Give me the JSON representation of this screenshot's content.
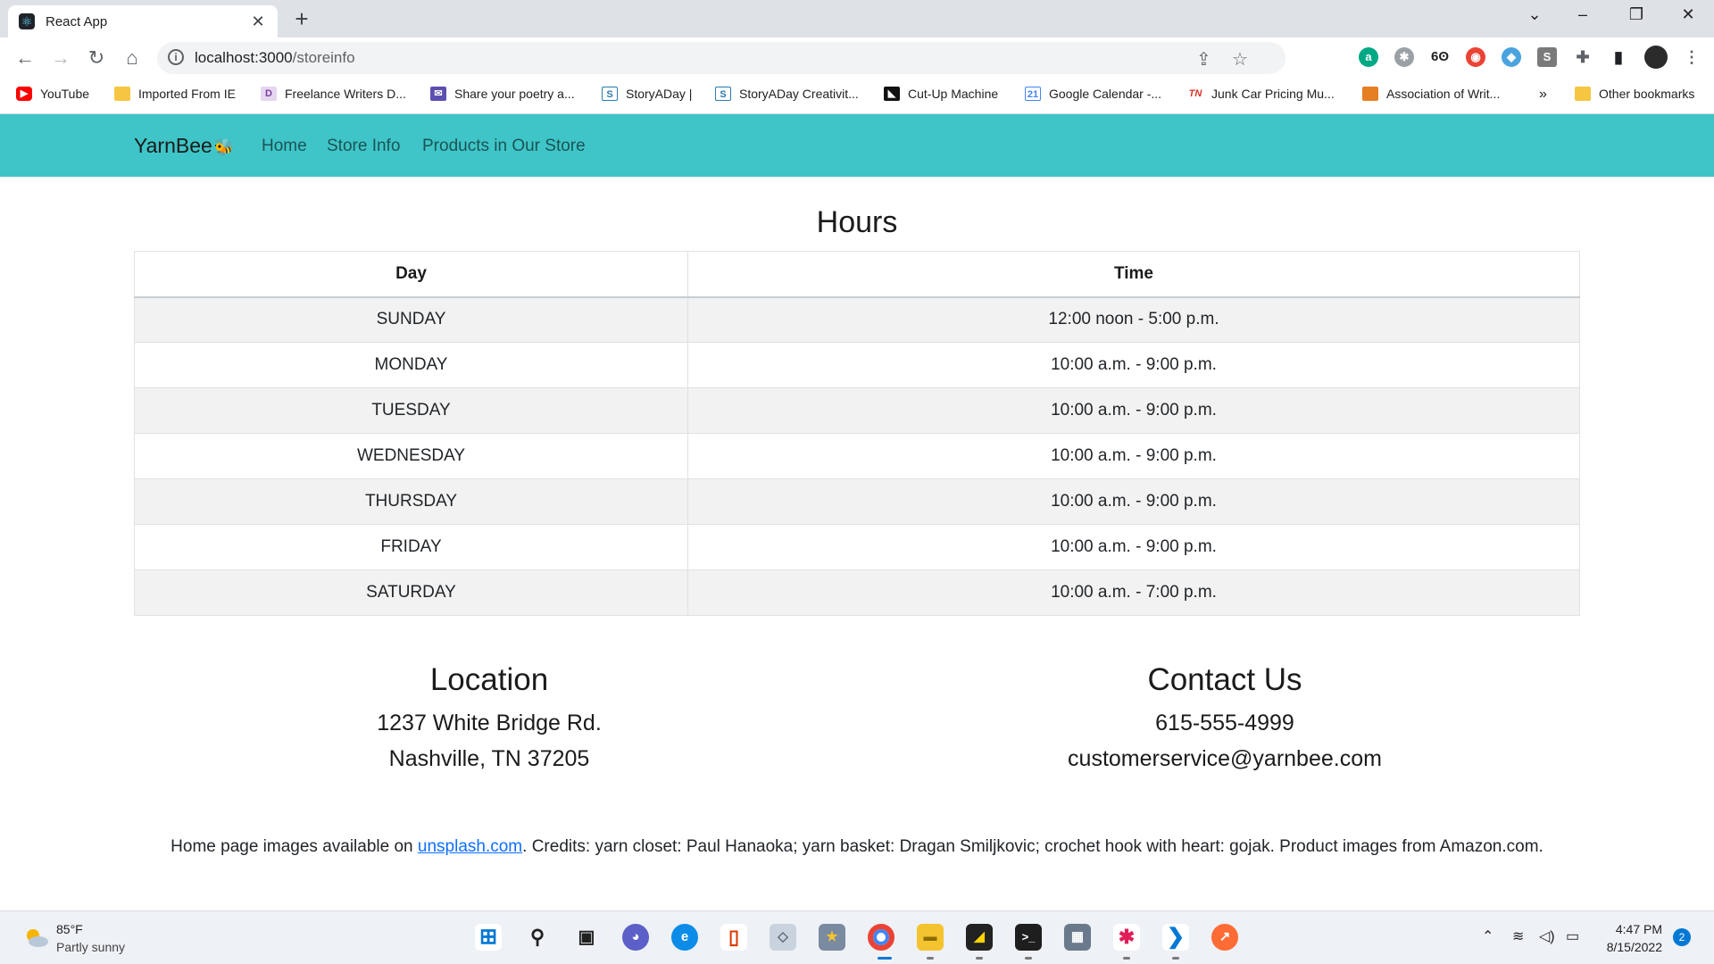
{
  "browser": {
    "tab_title": "React App",
    "url_host": "localhost:3000",
    "url_path": "/storeinfo",
    "bookmarks": [
      {
        "label": "YouTube",
        "icon": "youtube-icon",
        "color": "#ff0000"
      },
      {
        "label": "Imported From IE",
        "icon": "folder-icon",
        "color": "#f6c642"
      },
      {
        "label": "Freelance Writers D...",
        "icon": "d-icon",
        "color": "#9b59b6"
      },
      {
        "label": "Share your poetry a...",
        "icon": "poetry-icon",
        "color": "#5b4fb0"
      },
      {
        "label": "StoryADay |",
        "icon": "storyaday-icon",
        "color": "#2a7ab0"
      },
      {
        "label": "StoryADay Creativit...",
        "icon": "storyaday-icon",
        "color": "#2a7ab0"
      },
      {
        "label": "Cut-Up Machine",
        "icon": "cutup-icon",
        "color": "#111111"
      },
      {
        "label": "Google Calendar -...",
        "icon": "calendar-icon",
        "color": "#4285f4"
      },
      {
        "label": "Junk Car Pricing Mu...",
        "icon": "tn-icon",
        "color": "#d93025"
      },
      {
        "label": "Association of Writ...",
        "icon": "doc-icon",
        "color": "#e67e22"
      }
    ],
    "overflow_label": "»",
    "other_bookmarks": "Other bookmarks"
  },
  "nav": {
    "brand": "YarnBee",
    "links": [
      "Home",
      "Store Info",
      "Products in Our Store"
    ]
  },
  "hours": {
    "title": "Hours",
    "headers": [
      "Day",
      "Time"
    ],
    "rows": [
      {
        "day": "SUNDAY",
        "time": "12:00 noon - 5:00 p.m."
      },
      {
        "day": "MONDAY",
        "time": "10:00 a.m. - 9:00 p.m."
      },
      {
        "day": "TUESDAY",
        "time": "10:00 a.m. - 9:00 p.m."
      },
      {
        "day": "WEDNESDAY",
        "time": "10:00 a.m. - 9:00 p.m."
      },
      {
        "day": "THURSDAY",
        "time": "10:00 a.m. - 9:00 p.m."
      },
      {
        "day": "FRIDAY",
        "time": "10:00 a.m. - 9:00 p.m."
      },
      {
        "day": "SATURDAY",
        "time": "10:00 a.m. - 7:00 p.m."
      }
    ]
  },
  "location": {
    "title": "Location",
    "line1": "1237 White Bridge Rd.",
    "line2": "Nashville, TN 37205"
  },
  "contact": {
    "title": "Contact Us",
    "phone": "615-555-4999",
    "email": "customerservice@yarnbee.com"
  },
  "credits": {
    "prefix": "Home page images available on ",
    "link": "unsplash.com",
    "suffix": ". Credits: yarn closet: Paul Hanaoka; yarn basket: Dragan Smiljkovic; crochet hook with heart: gojak. Product images from Amazon.com."
  },
  "taskbar": {
    "temp": "85°F",
    "weather": "Partly sunny",
    "time": "4:47 PM",
    "date": "8/15/2022",
    "notifications": "2"
  },
  "colors": {
    "navbar": "#3fc5c8",
    "striped_row": "#f2f2f2",
    "link": "#0d6efd"
  }
}
